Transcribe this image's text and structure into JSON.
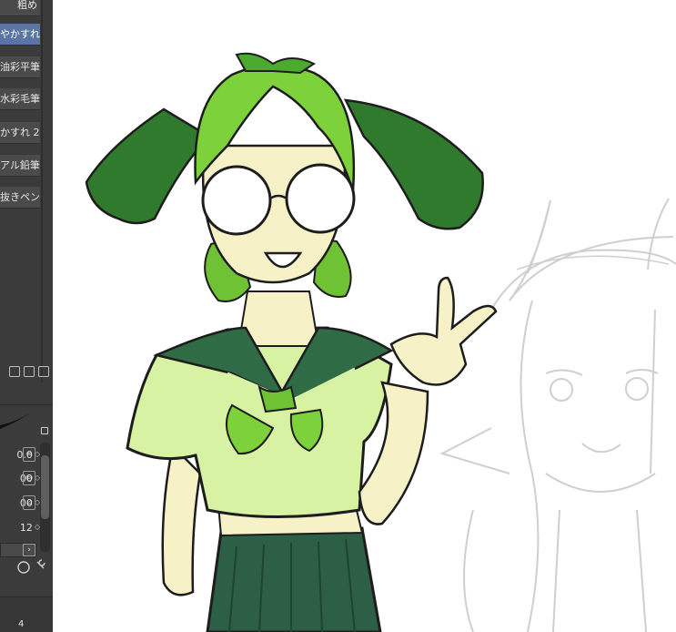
{
  "brushes": [
    {
      "label": "粗め",
      "selected": false
    },
    {
      "label": "やかすれ",
      "selected": true
    },
    {
      "label": "油彩平筆",
      "selected": false
    },
    {
      "label": "水彩毛筆",
      "selected": false
    },
    {
      "label": "かすれ 2",
      "selected": false
    },
    {
      "label": "アル鉛筆",
      "selected": false
    },
    {
      "label": "抜きペン",
      "selected": false
    }
  ],
  "properties": [
    {
      "value": "0.0"
    },
    {
      "value": "00"
    },
    {
      "value": "00"
    },
    {
      "value": "12"
    }
  ],
  "footer": {
    "page_number": "4"
  },
  "colors": {
    "panel_bg": "#3b3b3b",
    "selected": "#5a74a6",
    "hair": "#7dd13b",
    "hair_dark": "#2f7a2c",
    "shirt": "#d8f2a4",
    "collar": "#2f6b45",
    "skirt": "#2d5e46",
    "skin": "#f7f1c8",
    "sketch_line": "#cfcfcf"
  }
}
